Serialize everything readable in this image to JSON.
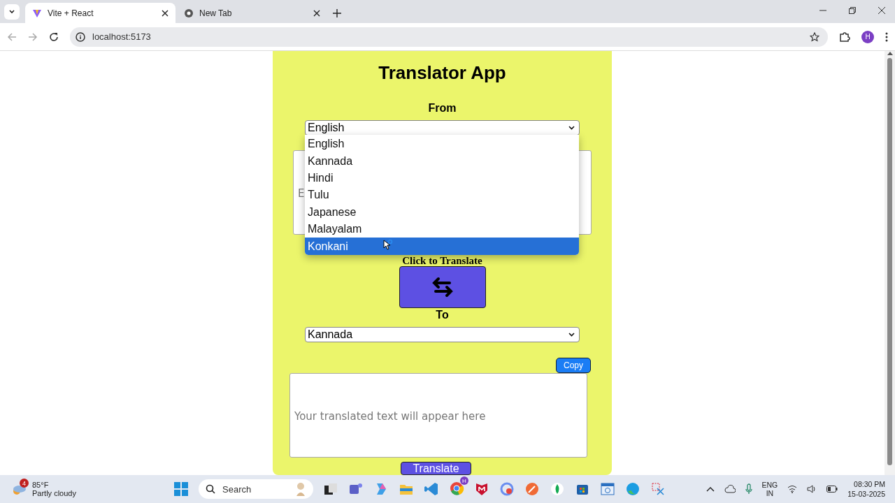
{
  "browser": {
    "tabs": [
      {
        "title": "Vite + React",
        "selected": true
      },
      {
        "title": "New Tab",
        "selected": false
      }
    ],
    "address": "localhost:5173",
    "profile_initial": "H"
  },
  "app": {
    "title": "Translator App",
    "from_label": "From",
    "from_select": {
      "value": "English",
      "options": [
        {
          "label": "English",
          "highlighted": false
        },
        {
          "label": "Kannada",
          "highlighted": false
        },
        {
          "label": "Hindi",
          "highlighted": false
        },
        {
          "label": "Tulu",
          "highlighted": false
        },
        {
          "label": "Japanese",
          "highlighted": false
        },
        {
          "label": "Malayalam",
          "highlighted": false
        },
        {
          "label": "Konkani",
          "highlighted": true
        }
      ]
    },
    "source_text": {
      "placeholder": "E"
    },
    "swap_label": "Click to Translate",
    "to_label": "To",
    "to_select": {
      "value": "Kannada"
    },
    "copy_button": "Copy",
    "output_text": {
      "placeholder": "Your translated text will appear here"
    },
    "translate_button": "Translate"
  },
  "taskbar": {
    "weather": {
      "badge": "4",
      "temperature": "85°F",
      "condition": "Partly cloudy"
    },
    "search_placeholder": "Search",
    "chrome_badge": "H",
    "language": {
      "line1": "ENG",
      "line2": "IN"
    },
    "time": "08:30 PM",
    "date": "15-03-2025"
  }
}
